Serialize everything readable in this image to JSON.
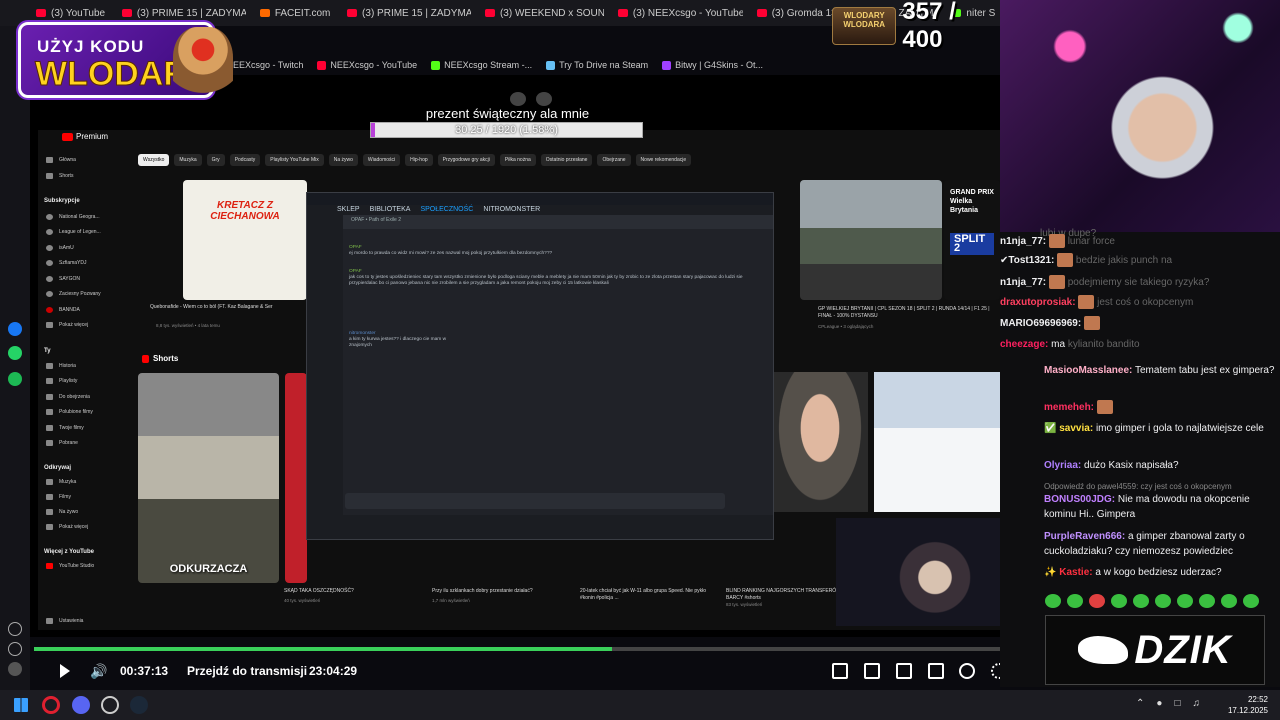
{
  "browser": {
    "tabs": [
      {
        "label": "(3) YouTube"
      },
      {
        "label": "(3) PRIME 15 | ZADYMA"
      },
      {
        "label": "FACEIT.com"
      },
      {
        "label": "(3) PRIME 15 | ZADYMA"
      },
      {
        "label": "(3) WEEKEND x SOUN"
      },
      {
        "label": "(3) NEEXcsgo - YouTube"
      },
      {
        "label": "(3) Gromda 13| Domi"
      },
      {
        "label": "15 | ZADYM"
      },
      {
        "label": "niter S"
      }
    ],
    "bookmarks": [
      {
        "label": "(6) NEEXcsgo - Twitch",
        "color": "#9147ff"
      },
      {
        "label": "NEEXcsgo - YouTube",
        "color": "#ff0033"
      },
      {
        "label": "NEEXcsgo Stream -...",
        "color": "#53fc18"
      },
      {
        "label": "Try To Drive na Steam",
        "color": "#66c0f4"
      },
      {
        "label": "Bitwy | G4Skins - Ot...",
        "color": "#a040ff"
      }
    ]
  },
  "promo": {
    "line1": "UŻYJ KODU",
    "line2": "WLODAR"
  },
  "counter": {
    "badge": "WLODARY WLODARA",
    "value": "357 / 400"
  },
  "gift": {
    "title": "prezent świąteczny ala mnie",
    "progress": "30.25 / 1920 (1.58%)",
    "fraction": 0.0158
  },
  "youtube": {
    "premium": "Premium",
    "nav": [
      "Główna",
      "Shorts"
    ],
    "subs_header": "Subskrypcje",
    "subs": [
      "National Geogra...",
      "League of Legen...",
      "isAmU",
      "SzfiamaYDJ",
      "SAYGON",
      "Zaciesny Pozwany",
      "BANNDA",
      "Pokaż więcej"
    ],
    "you_header": "Ty",
    "you": [
      "Historia",
      "Playlisty",
      "Do obejrzenia",
      "Polubione filmy",
      "Twoje filmy",
      "Pobrane"
    ],
    "explore_header": "Odkrywaj",
    "explore": [
      "Muzyka",
      "Filmy",
      "Na żywo",
      "Pokaż więcej"
    ],
    "more_header": "Więcej z YouTube",
    "more": [
      "YouTube Studio"
    ],
    "settings": "Ustawienia",
    "chips": [
      "Wszystko",
      "Muzyka",
      "Gry",
      "Podcasty",
      "Playlisty YouTube Mix",
      "Na żywo",
      "Wiadomości",
      "Hip-hop",
      "Przygodowe gry akcji",
      "Piłka nożna",
      "Ostatnio przesłane",
      "Obejrzane",
      "Nowe rekomendacje"
    ],
    "shorts_label": "Shorts",
    "kretacz": "KRETACZ Z CIECHANOWA",
    "odkurzacza": "ODKURZACZA",
    "split": "SPLIT 2",
    "grand_prix": "GRAND PRIX Wielka Brytania",
    "videos": [
      {
        "title": "Quebonafide - Wiem co to ból (FT. Kaz Balagane & Ser",
        "meta": "8,8 tys. wyświetleń • 4 lata temu"
      },
      {
        "title": "GP WIELKIEJ BRYTANII | CPL SEZON 18 | SPLIT 2 | RUNDA 14/14 | F1 25 | FINAŁ - 100% DYSTANSU",
        "meta": "CPLeague • 3 oglądających"
      },
      {
        "title": "SKĄD TAKA OSZCZĘDNOŚĆ?",
        "meta": "40 tys. wyświetleń"
      },
      {
        "title": "Przy ilu szklankach dobry przestanie działać?",
        "meta": "1,7 mln wyświetleń"
      },
      {
        "title": "20-latek chciał być jak W-11 albo grupa Speed. Nie pykło #konin #policja ...",
        "meta": ""
      },
      {
        "title": "BLIND RANKING NAJGORSZYCH TRANSFERÓW BARCY #shorts",
        "meta": "83 tys. wyświetleń"
      }
    ]
  },
  "steam": {
    "menu": [
      "SKLEP",
      "BIBLIOTEKA",
      "SPOŁECZNOŚĆ",
      "NITROMONSTER"
    ],
    "active_menu": "SPOŁECZNOŚĆ",
    "chat_header": "OPAF • Path of Exile 2",
    "messages": [
      {
        "user": "OPAF",
        "text": "ej mordo to prawda co widz mi mowi? ze zes nazwal moj pokoj przytulkiem dla bezdomnych???"
      },
      {
        "user": "OPAF",
        "text": "jak cos to ty jestes upośledzieniec stary tam wszystko zmienione było podloga sciany meble a meblety ja nie mam 50min jak ty by zrobic to ze zlota przestan stary pajacowac do ludzi sie przypierdalac bo ci panowo jebana nic nie zrobilem a sie przygladam a jaka remont pokoju moj zeby ci 15 latkowie klaskali"
      },
      {
        "user": "nitromonster",
        "text": "a kim ty kurwa jestes?? i dlaczego cie mam w znajomych"
      }
    ]
  },
  "player": {
    "elapsed": "00:37:13",
    "jump": "Przejdź do transmisji",
    "total": "23:04:29",
    "progress": 0.58
  },
  "chat": [
    {
      "user": "n1nja_77:",
      "text": "",
      "ucolor": "#efeff1"
    },
    {
      "user": "Tost1321:",
      "text": "",
      "ucolor": "#efeff1"
    },
    {
      "user": "n1nja_77:",
      "text": "",
      "ucolor": "#efeff1"
    },
    {
      "user": "draxutoprosiak:",
      "text": "",
      "ucolor": "#ff4060"
    },
    {
      "user": "MARIO69696969:",
      "text": "",
      "ucolor": "#efeff1"
    },
    {
      "user": "cheezage:",
      "text": "ma",
      "ucolor": "#ff2060"
    },
    {
      "user": "MasiooMasslanee:",
      "text": "Tematem tabu jest ex gimpera?",
      "ucolor": "#ffb0c8"
    },
    {
      "user": "memeheh:",
      "text": "",
      "ucolor": "#ff3060"
    },
    {
      "user": "savvia:",
      "text": "imo gimper i gola to najlatwiejsze cele",
      "ucolor": "#ffe040"
    },
    {
      "user": "Olyriaa:",
      "text": "dużo Kasix napisała?",
      "ucolor": "#b080ff"
    },
    {
      "user": "BONUS00JDG:",
      "text": "Nie ma dowodu na okopcenie kominu Hi.. Gimpera",
      "ucolor": "#c080ff"
    },
    {
      "user": "PurpleRaven666:",
      "text": "a gimper zbanowal zarty o cuckoladziaku? czy niemozesz powiedziec",
      "ucolor": "#c090ff"
    },
    {
      "user": "Kastie:",
      "text": "a w kogo bedziesz uderzac?",
      "ucolor": "#ff3040"
    }
  ],
  "chat_faded": [
    {
      "text": "lubi w dupe?"
    },
    {
      "text": "lunar force"
    },
    {
      "text": "bedzie jakis punch na"
    },
    {
      "text": "podejmiemy sie takiego ryzyka?"
    },
    {
      "text": "jest coś o okopcenym"
    },
    {
      "text": "kylianito bandito"
    }
  ],
  "reply_note": "Odpowiedź do pawel4559: czy jest coś o okopcenym",
  "dzik": "DZIK",
  "taskbar": {
    "time": "22:52",
    "date": "17.12.2025"
  }
}
